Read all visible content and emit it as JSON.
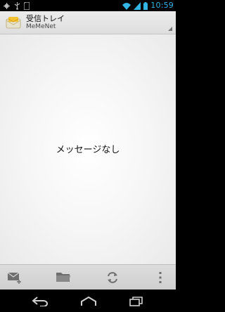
{
  "status_bar": {
    "time": "10:59",
    "left_icons": [
      "usb-debug-icon",
      "usb-icon",
      "sd-card-icon"
    ],
    "right_icons": [
      "wifi-icon",
      "signal-icon",
      "battery-icon"
    ],
    "accent_color": "#33b5e5"
  },
  "action_bar": {
    "title": "受信トレイ",
    "subtitle": "MeMeNet",
    "icon": "mail-app-icon"
  },
  "content": {
    "empty_message": "メッセージなし"
  },
  "bottom_bar": {
    "buttons": [
      "compose-mail-icon",
      "folder-icon",
      "refresh-icon",
      "overflow-menu-icon"
    ]
  },
  "nav_bar": {
    "buttons": [
      "back-icon",
      "home-icon",
      "recent-apps-icon"
    ]
  }
}
